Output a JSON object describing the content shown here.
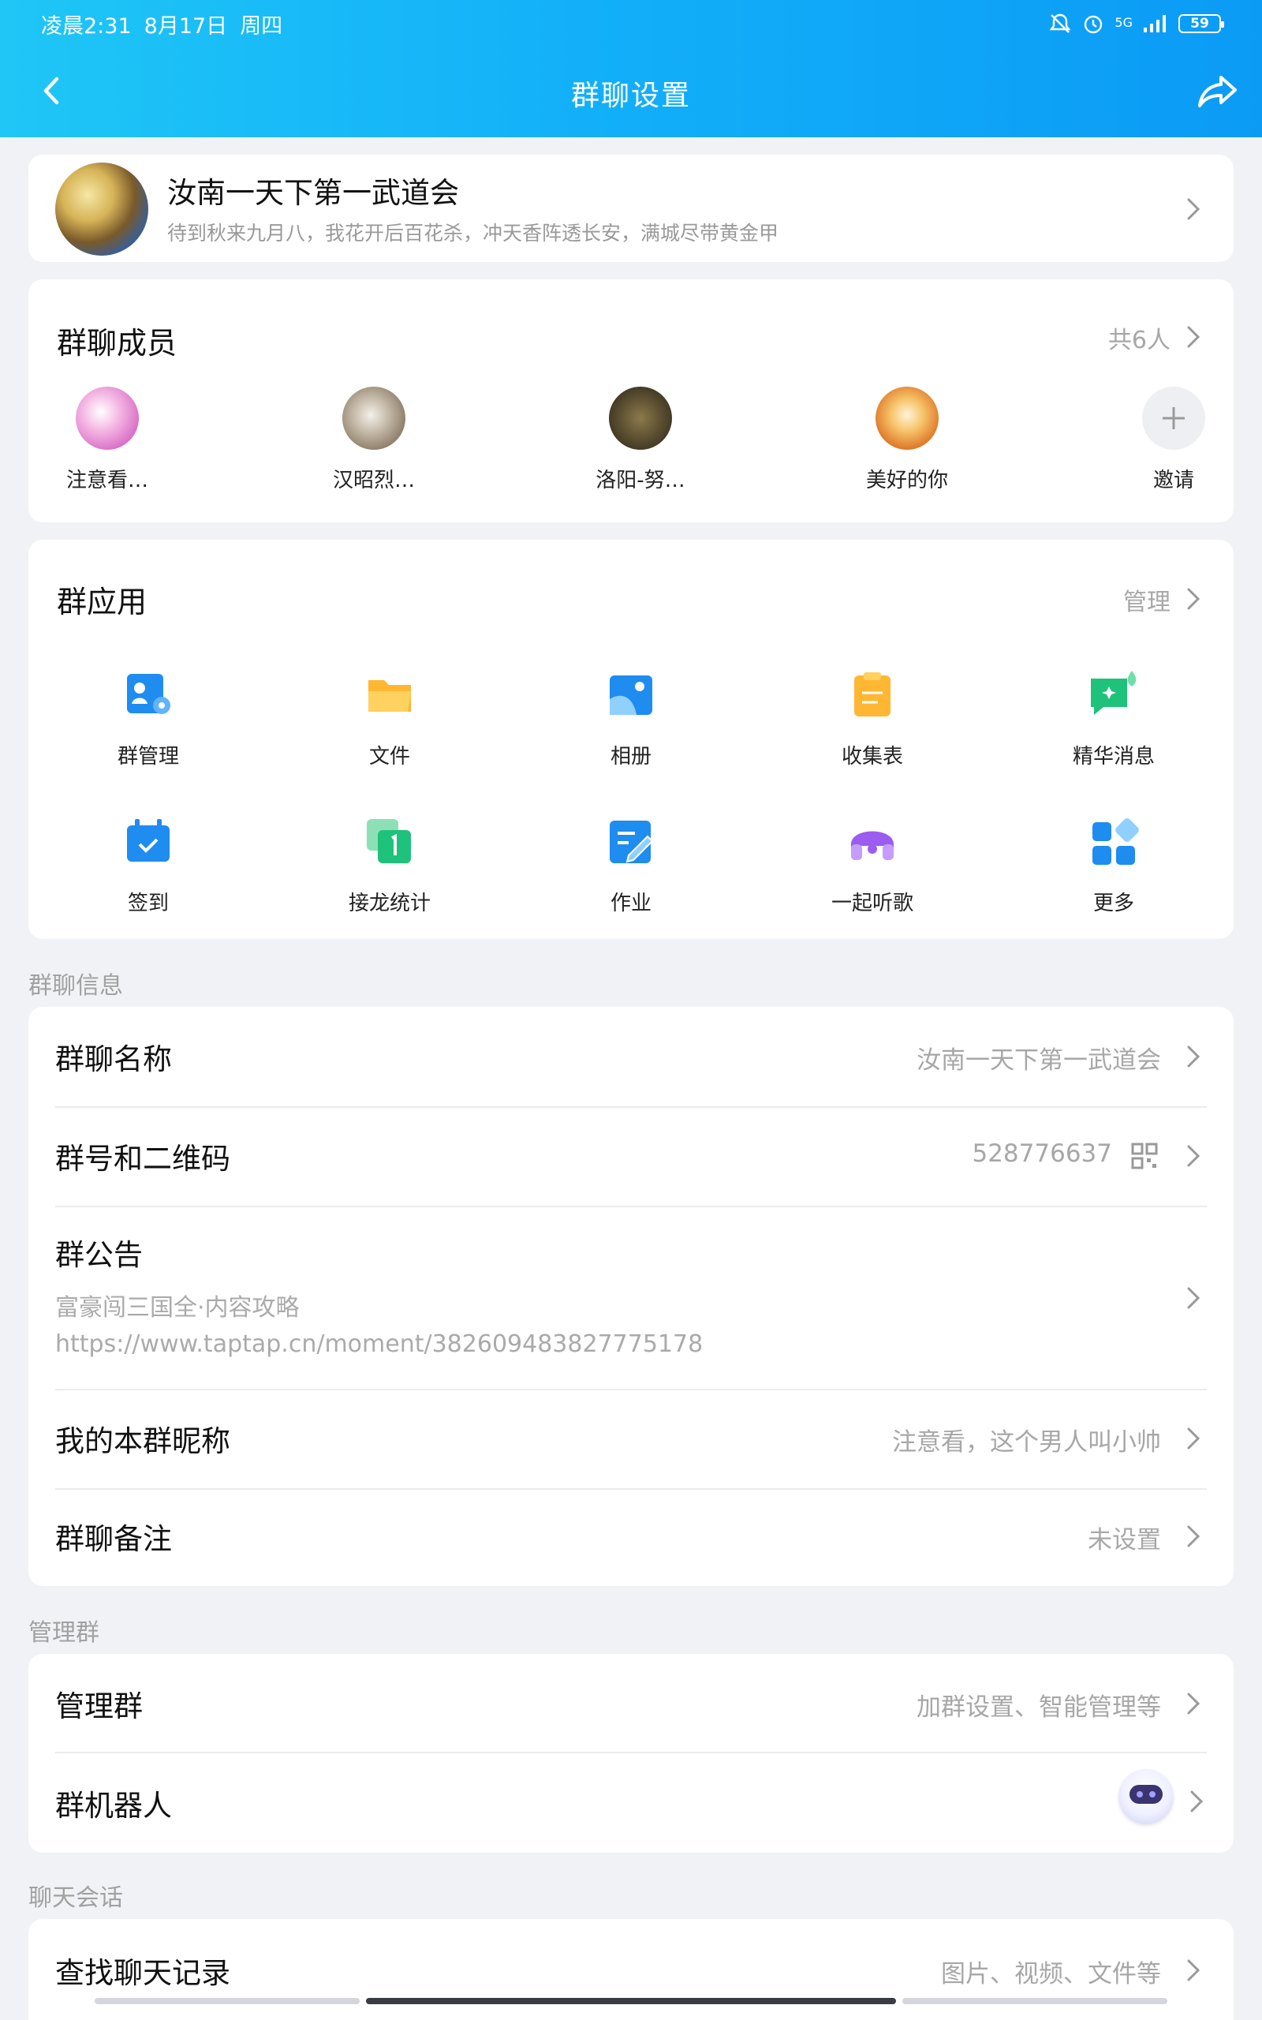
{
  "status_bar": {
    "time": "凌晨2:31",
    "date": "8月17日",
    "weekday": "周四",
    "network": "5G",
    "battery": "59"
  },
  "nav": {
    "title": "群聊设置"
  },
  "group": {
    "name": "汝南一天下第一武道会",
    "description": "待到秋来九月八，我花开后百花杀，冲天香阵透长安，满城尽带黄金甲"
  },
  "members": {
    "title": "群聊成员",
    "count_label": "共6人",
    "items": [
      {
        "name": "注意看…",
        "color": "#f1a6d8"
      },
      {
        "name": "汉昭烈…",
        "color": "#9d8f7c"
      },
      {
        "name": "洛阳-努…",
        "color": "#6a5d3a"
      },
      {
        "name": "美好的你",
        "color": "#e89a3a"
      }
    ],
    "invite_label": "邀请"
  },
  "apps": {
    "title": "群应用",
    "manage_label": "管理",
    "items": [
      {
        "label": "群管理",
        "icon": "group-manage-icon",
        "color": "#1f8cf0"
      },
      {
        "label": "文件",
        "icon": "folder-icon",
        "color": "#ffb733"
      },
      {
        "label": "相册",
        "icon": "album-icon",
        "color": "#1f8cf0"
      },
      {
        "label": "收集表",
        "icon": "clipboard-icon",
        "color": "#ffb733"
      },
      {
        "label": "精华消息",
        "icon": "essence-message-icon",
        "color": "#1fc27a"
      },
      {
        "label": "签到",
        "icon": "check-in-icon",
        "color": "#1f8cf0"
      },
      {
        "label": "接龙统计",
        "icon": "relay-icon",
        "color": "#1fc27a"
      },
      {
        "label": "作业",
        "icon": "homework-icon",
        "color": "#1f8cf0"
      },
      {
        "label": "一起听歌",
        "icon": "listen-together-icon",
        "color": "#9b5cf0"
      },
      {
        "label": "更多",
        "icon": "more-apps-icon",
        "color": "#1f8cf0"
      }
    ]
  },
  "group_info": {
    "section_label": "群聊信息",
    "name_row": {
      "title": "群聊名称",
      "value": "汝南一天下第一武道会"
    },
    "number_row": {
      "title": "群号和二维码",
      "value": "528776637"
    },
    "notice_row": {
      "title": "群公告",
      "line1": "富豪闯三国全·内容攻略",
      "line2": "https://www.taptap.cn/moment/382609483827775178"
    },
    "nickname_row": {
      "title": "我的本群昵称",
      "value": "注意看，这个男人叫小帅"
    },
    "remark_row": {
      "title": "群聊备注",
      "value": "未设置"
    }
  },
  "manage": {
    "section_label": "管理群",
    "manage_row": {
      "title": "管理群",
      "value": "加群设置、智能管理等"
    },
    "robot_row": {
      "title": "群机器人"
    }
  },
  "chat": {
    "section_label": "聊天会话",
    "search_row": {
      "title": "查找聊天记录",
      "value": "图片、视频、文件等"
    }
  }
}
